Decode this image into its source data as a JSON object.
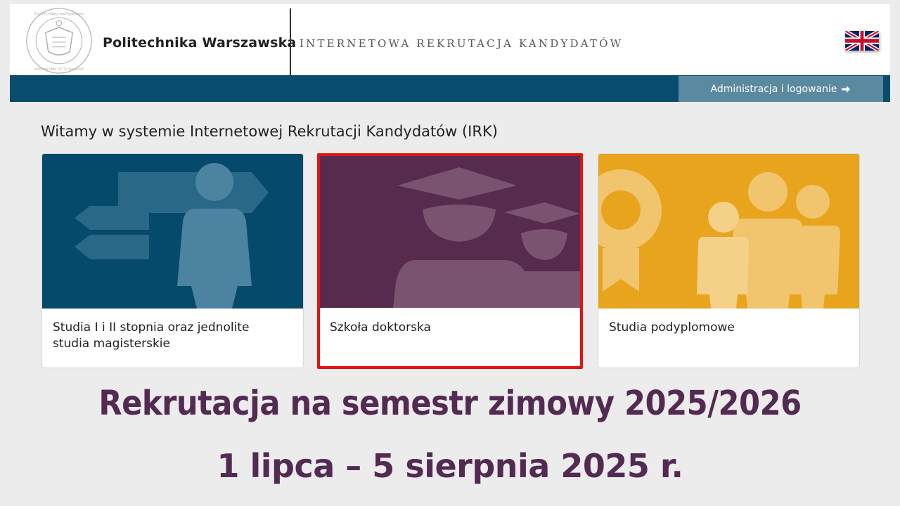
{
  "header": {
    "university_name": "Politechnika Warszawska",
    "system_title": "INTERNETOWA REKRUTACJA KANDYDATÓW",
    "seal_text": "POLITECHNIKA WARSZAWSKA · WARSAW UNIVERSITY OF TECHNOLOGY",
    "language_flag": "uk-flag-icon"
  },
  "navbar": {
    "admin_label": "Administracja i logowanie",
    "admin_icon": "arrow-right-icon"
  },
  "welcome": "Witamy w systemie Internetowej Rekrutacji Kandydatów (IRK)",
  "cards": [
    {
      "label": "Studia I i II stopnia oraz jednolite studia magisterskie",
      "color": "#05496b"
    },
    {
      "label": "Szkoła doktorska",
      "color": "#572b4e"
    },
    {
      "label": "Studia podyplomowe",
      "color": "#e8a41c"
    }
  ],
  "announcement": {
    "line1": "Rekrutacja na semestr zimowy 2025/2026",
    "line2": "1 lipca – 5 sierpnia 2025 r."
  },
  "colors": {
    "navbar": "#084d6e",
    "admin_button": "#5b8aa0",
    "announcement_text": "#532a52",
    "selection_outline": "#e41212"
  }
}
